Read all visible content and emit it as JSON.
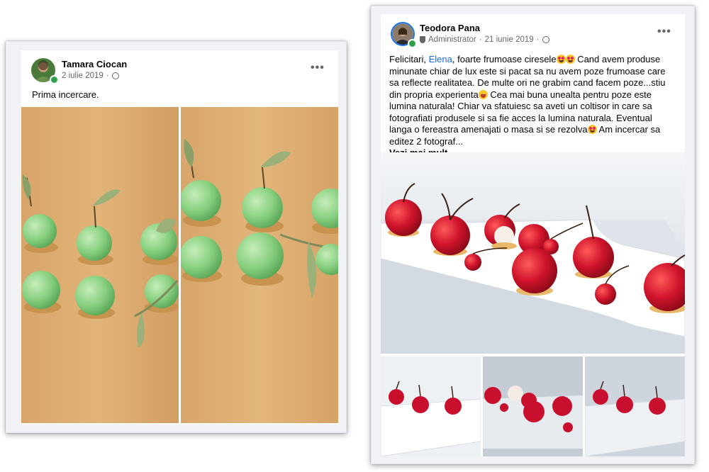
{
  "post_left": {
    "author": "Tamara Ciocan",
    "date": "2 iulie 2019",
    "privacy_icon": "globe-icon",
    "menu_label": "•••",
    "text": "Prima incercare.",
    "photos": [
      "green apple desserts on wooden table",
      "green apple desserts close-up"
    ]
  },
  "post_right": {
    "author": "Teodora Pana",
    "role": "Administrator",
    "date": "21 iunie 2019",
    "role_icon": "shield-icon",
    "privacy_icon": "globe-icon",
    "menu_label": "•••",
    "text_before_mention": "Felicitari, ",
    "mention": "Elena",
    "text_line1_rest": ", foarte frumoase ciresele",
    "text_part2": " Cand avem produse minunate chiar de lux este si pacat sa nu avem poze frumoase care sa reflecte realitatea. De multe ori ne grabim cand facem poze...stiu din propria experienta",
    "text_part3": " Cea mai buna unealta pentru poze este lumina naturala! Chiar va sfatuiesc sa aveti un coltisor in care sa fotografiati produsele si sa fie acces la lumina naturala. Eventual langa o fereastra amenajati o masa si se rezolva",
    "text_part4": " Am incercar sa editez 2 fotograf...",
    "see_more": "Vezi mai mult"
  },
  "colors": {
    "link": "#216fdb",
    "meta": "#65676b",
    "online": "#31a24c",
    "wood": "#d9a86a",
    "apple": "#8fd18a",
    "cherry": "#c8102e"
  }
}
